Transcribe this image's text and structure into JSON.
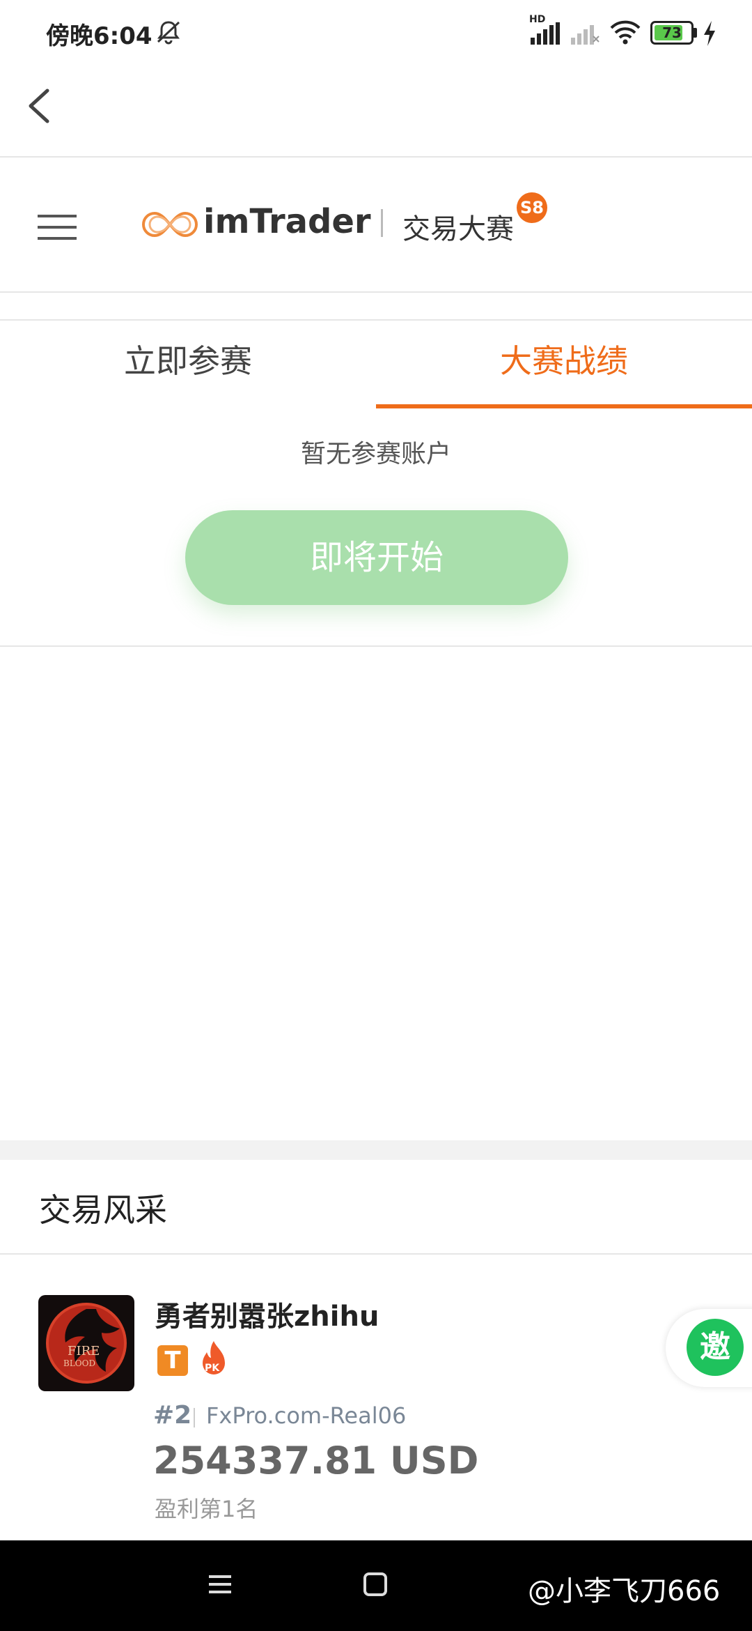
{
  "status_bar": {
    "time": "傍晚6:04",
    "battery": "73",
    "network_label": "HD"
  },
  "brand": {
    "name": "imTrader",
    "subtitle": "交易大赛",
    "season": "S8"
  },
  "tabs": [
    {
      "label": "立即参赛",
      "active": false
    },
    {
      "label": "大赛战绩",
      "active": true
    }
  ],
  "results": {
    "empty_text": "暂无参赛账户",
    "start_button": "即将开始"
  },
  "section": {
    "title": "交易风采"
  },
  "trader": {
    "name": "勇者别嚣张zhihu",
    "badge_t": "T",
    "badge_pk": "PK",
    "rank": "#2",
    "server": "FxPro.com-Real06",
    "profit": "254337.81 USD",
    "profit_rank": "盈利第1名",
    "avatar_text": [
      "FIRE",
      "BLOOD"
    ]
  },
  "invite_button": "邀",
  "watermark": "@小李飞刀666",
  "colors": {
    "accent": "#ef6c1a",
    "start_button": "#a9dfac",
    "invite": "#1fc25d"
  }
}
